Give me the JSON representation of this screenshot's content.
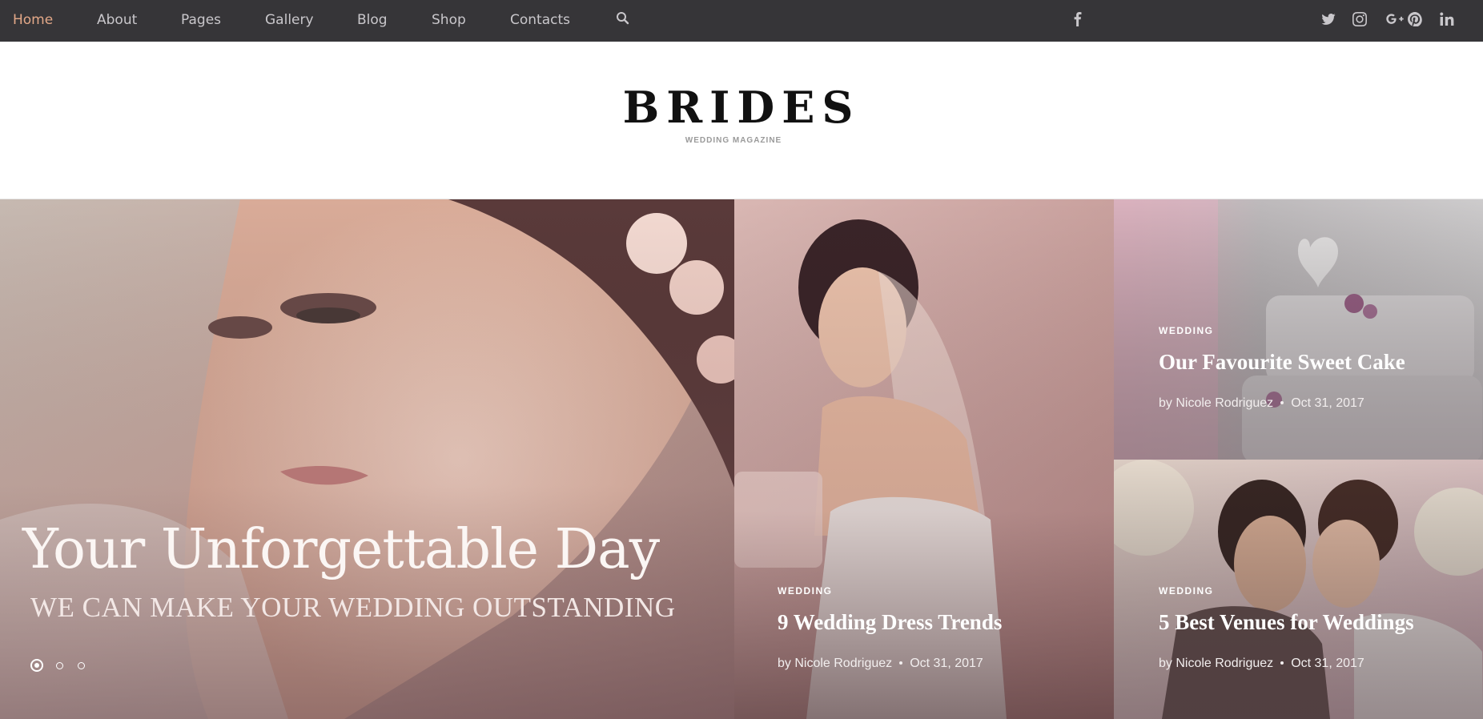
{
  "nav": {
    "items": [
      {
        "label": "Home",
        "active": true
      },
      {
        "label": "About",
        "active": false
      },
      {
        "label": "Pages",
        "active": false
      },
      {
        "label": "Gallery",
        "active": false
      },
      {
        "label": "Blog",
        "active": false
      },
      {
        "label": "Shop",
        "active": false
      },
      {
        "label": "Contacts",
        "active": false
      }
    ],
    "search_icon": "search-icon",
    "social_icons": [
      "facebook-icon",
      "twitter-icon",
      "instagram-icon",
      "google-plus-icon",
      "pinterest-icon",
      "linkedin-icon"
    ]
  },
  "header": {
    "logo_title": "BRIDES",
    "logo_subtitle": "WEDDING MAGAZINE"
  },
  "hero": {
    "title": "Your Unforgettable Day",
    "subtitle": "WE CAN MAKE YOUR WEDDING OUTSTANDING",
    "slides_count": 3,
    "active_slide": 1
  },
  "cards": [
    {
      "category": "WEDDING",
      "title": "9 Wedding Dress Trends",
      "author": "by Nicole Rodriguez",
      "date": "Oct 31, 2017"
    },
    {
      "category": "WEDDING",
      "title": "Our Favourite Sweet Cake",
      "author": "by Nicole Rodriguez",
      "date": "Oct 31, 2017"
    },
    {
      "category": "WEDDING",
      "title": "5 Best Venues for Weddings",
      "author": "by Nicole Rodriguez",
      "date": "Oct 31, 2017"
    }
  ],
  "colors": {
    "topbar": "#363538",
    "nav_text": "#c9c7cb",
    "nav_active": "#e3a888",
    "logo": "#111111"
  }
}
